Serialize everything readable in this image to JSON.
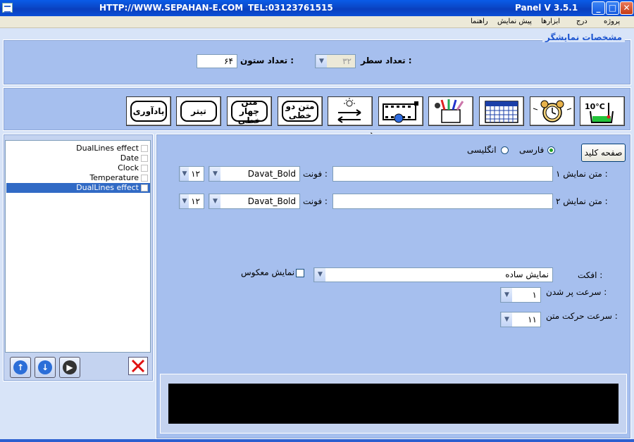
{
  "titlebar": {
    "url": "HTTP://WWW.SEPAHAN-E.COM",
    "tel": "TEL:03123761515",
    "app_title": "Panel V 3.5.1",
    "minimize_glyph": "_",
    "maximize_glyph": "□",
    "close_glyph": "✕"
  },
  "menu": {
    "project": "پروژه",
    "insert": "درج",
    "tools": "ابزارها",
    "preview": "پیش نمایش",
    "help": "راهنما"
  },
  "display": {
    "section_title": "مشخصات نمایشگر",
    "rows_label": "تعداد سطر :",
    "rows_value": "۳۲",
    "cols_label": "تعداد ستون :",
    "cols_value": "۶۴"
  },
  "toolbar": {
    "icons": [
      "temperature-icon",
      "alarm-clock-icon",
      "calendar-icon",
      "paint-tools-icon",
      "film-video-icon",
      "dual-lines-effect-icon"
    ],
    "two_line_text": "متن دو خطی",
    "four_line_text": "متن چهار خطی",
    "headline": "تیتر",
    "reminder": "یادآوری"
  },
  "list": {
    "items": [
      {
        "label": "DualLines effect",
        "selected": false
      },
      {
        "label": "Date",
        "selected": false
      },
      {
        "label": "Clock",
        "selected": false
      },
      {
        "label": "Temperature",
        "selected": false
      },
      {
        "label": "DualLines effect",
        "selected": true
      }
    ]
  },
  "editor": {
    "keyboard_button": "صفحه کلید",
    "lang_farsi": "فارسی",
    "lang_english": "انگلیسی",
    "text1_label": "متن نمایش ۱ :",
    "text2_label": "متن نمایش ۲ :",
    "text1_value": "",
    "text2_value": "",
    "font_label": "فونت :",
    "font1_value": "Davat_Bold",
    "font2_value": "Davat_Bold",
    "size1_value": "۱۲",
    "size2_value": "۱۲",
    "effect_label": "افکت :",
    "effect_value": "نمایش ساده",
    "reverse_label": "نمایش معکوس",
    "fill_speed_label": "سرعت پر شدن :",
    "fill_speed_value": "۱",
    "move_speed_label": "سرعت حرکت متن :",
    "move_speed_value": "۱۱"
  }
}
